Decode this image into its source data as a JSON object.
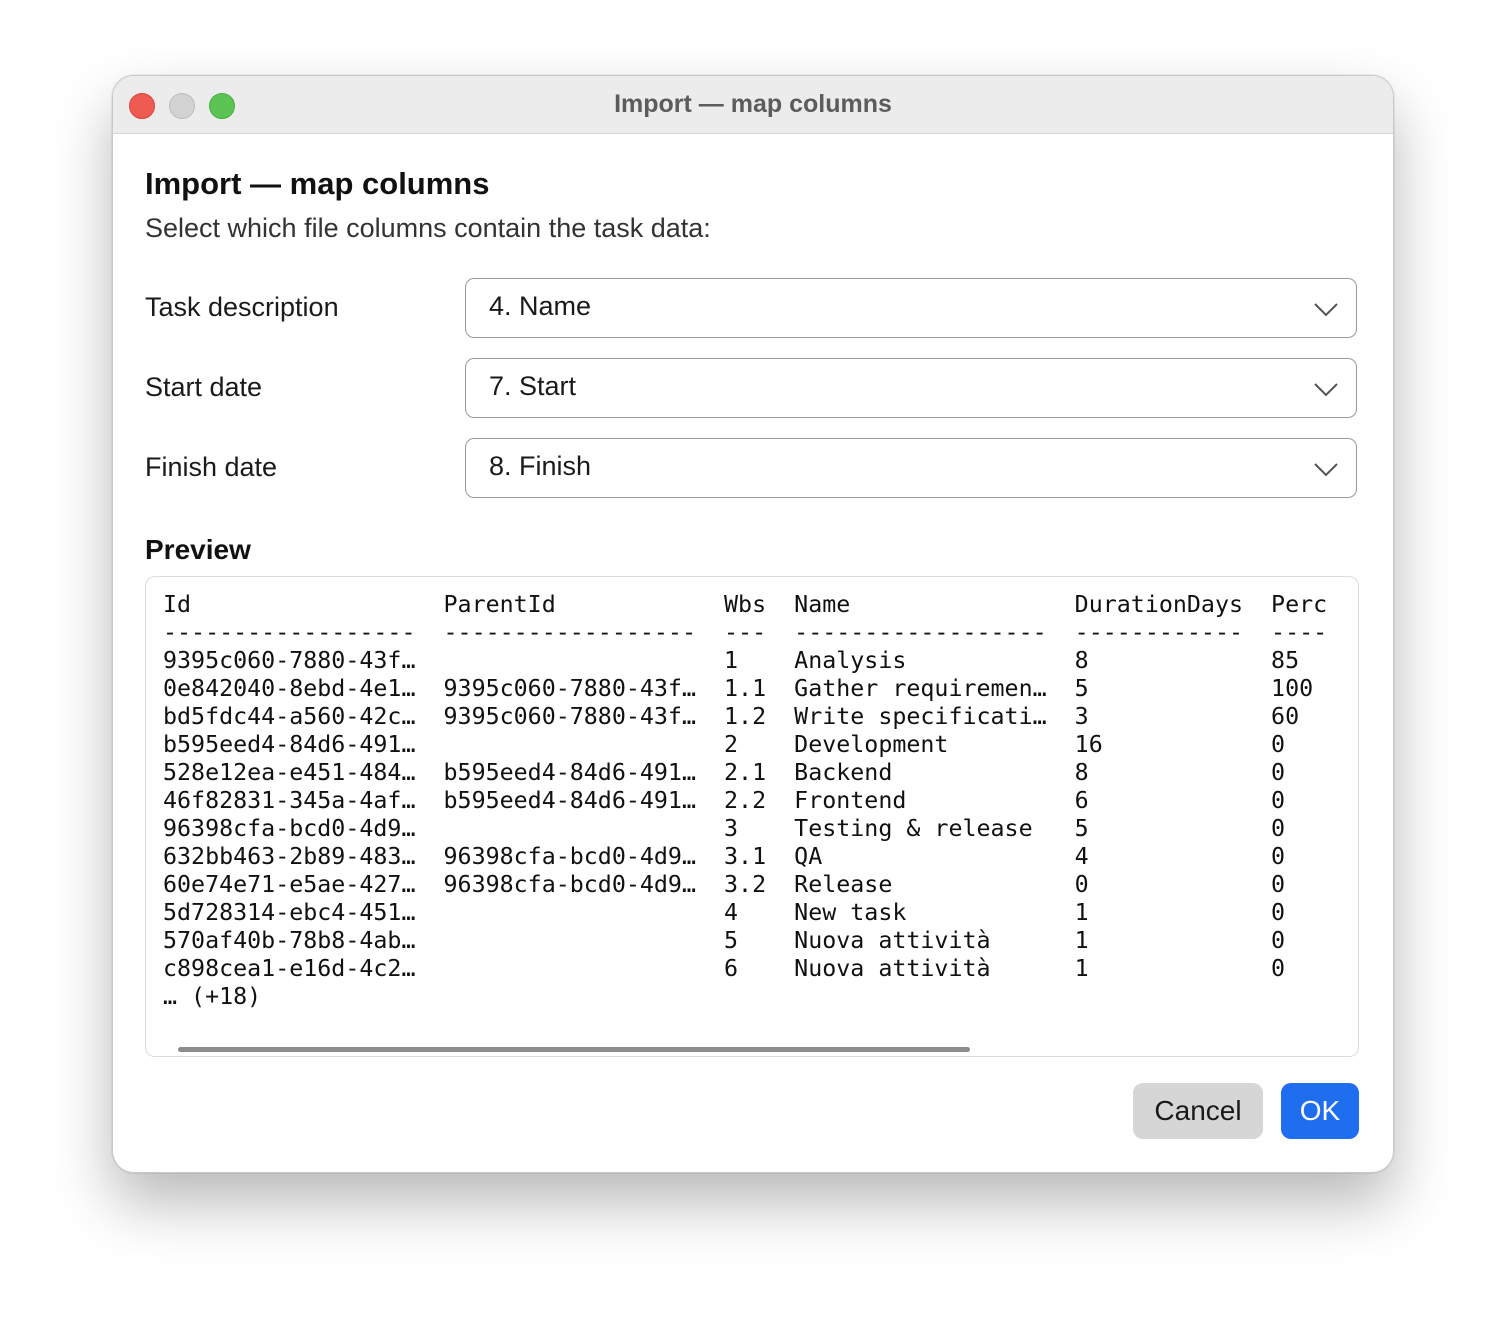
{
  "window": {
    "title": "Import — map columns"
  },
  "dialog": {
    "heading": "Import — map columns",
    "subheading": "Select which file columns contain the task data:"
  },
  "fields": [
    {
      "label": "Task description",
      "value": "4. Name"
    },
    {
      "label": "Start date",
      "value": "7. Start"
    },
    {
      "label": "Finish date",
      "value": "8. Finish"
    }
  ],
  "preview": {
    "label": "Preview",
    "columns": [
      "Id",
      "ParentId",
      "Wbs",
      "Name",
      "DurationDays",
      "Perc"
    ],
    "rows": [
      [
        "9395c060-7880-43f…",
        "",
        "1",
        "Analysis",
        "8",
        "85"
      ],
      [
        "0e842040-8ebd-4e1…",
        "9395c060-7880-43f…",
        "1.1",
        "Gather requiremen…",
        "5",
        "100"
      ],
      [
        "bd5fdc44-a560-42c…",
        "9395c060-7880-43f…",
        "1.2",
        "Write specificati…",
        "3",
        "60"
      ],
      [
        "b595eed4-84d6-491…",
        "",
        "2",
        "Development",
        "16",
        "0"
      ],
      [
        "528e12ea-e451-484…",
        "b595eed4-84d6-491…",
        "2.1",
        "Backend",
        "8",
        "0"
      ],
      [
        "46f82831-345a-4af…",
        "b595eed4-84d6-491…",
        "2.2",
        "Frontend",
        "6",
        "0"
      ],
      [
        "96398cfa-bcd0-4d9…",
        "",
        "3",
        "Testing & release",
        "5",
        "0"
      ],
      [
        "632bb463-2b89-483…",
        "96398cfa-bcd0-4d9…",
        "3.1",
        "QA",
        "4",
        "0"
      ],
      [
        "60e74e71-e5ae-427…",
        "96398cfa-bcd0-4d9…",
        "3.2",
        "Release",
        "0",
        "0"
      ],
      [
        "5d728314-ebc4-451…",
        "",
        "4",
        "New task",
        "1",
        "0"
      ],
      [
        "570af40b-78b8-4ab…",
        "",
        "5",
        "Nuova attività",
        "1",
        "0"
      ],
      [
        "c898cea1-e16d-4c2…",
        "",
        "6",
        "Nuova attività",
        "1",
        "0"
      ]
    ],
    "more": "… (+18)"
  },
  "buttons": {
    "cancel": "Cancel",
    "ok": "OK"
  },
  "colors": {
    "accent": "#1f6ef0",
    "close": "#ee5b52",
    "minimize": "#d2d2d2",
    "maximize": "#5cc454"
  }
}
